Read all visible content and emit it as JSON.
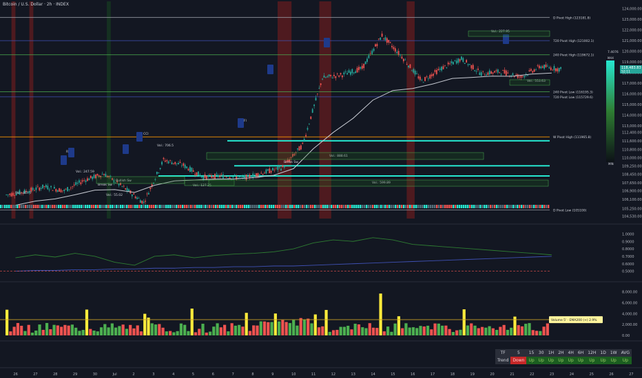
{
  "header": {
    "title": "Bitcoin / U.S. Dollar · 2h · INDEX"
  },
  "chart_data": [
    {
      "type": "line",
      "name": "price",
      "x": [
        "26",
        "27",
        "28",
        "29",
        "30",
        "Jul",
        "2",
        "3",
        "4",
        "5",
        "6",
        "7",
        "8",
        "9",
        "10",
        "11",
        "12",
        "13",
        "14",
        "15",
        "16",
        "17",
        "18",
        "19",
        "20",
        "21",
        "22",
        "23"
      ],
      "close": [
        106800,
        107300,
        106900,
        107900,
        108500,
        107200,
        105800,
        109800,
        109300,
        108200,
        108300,
        108100,
        108600,
        109100,
        111200,
        117500,
        117800,
        118400,
        121500,
        119500,
        117200,
        118400,
        119300,
        117900,
        118100,
        117600,
        118600,
        118300
      ],
      "y_ticks": [
        124000,
        123000,
        122000,
        121000,
        120000,
        119000,
        118000,
        117000,
        116000,
        115000,
        114000,
        113000,
        112400,
        111600,
        110800,
        110000,
        109250,
        108450,
        107650,
        106900,
        106100,
        105250,
        104530
      ],
      "last_price": "118,483.83",
      "last_price_sub": "52:11",
      "ylim": [
        104300,
        124300
      ],
      "pivot_lines": [
        {
          "label": "D Pivot High (123181.8)",
          "value": 123181.8,
          "color": "#9598a1"
        },
        {
          "label": "720 Pivot High (121002.1)",
          "value": 121002.1,
          "color": "#3f51b5"
        },
        {
          "label": "240 Pivot High (119672.1)",
          "value": 119672.1,
          "color": "#4caf50"
        },
        {
          "label": "240 Pivot Low (116195.3)",
          "value": 116195.3,
          "color": "#4caf50"
        },
        {
          "label": "720 Pivot Low (115729.6)",
          "value": 115729.6,
          "color": "#3f51b5"
        },
        {
          "label": "W Pivot High (111965.8)",
          "value": 111965.8,
          "color": "#ff9800"
        },
        {
          "label": "D Pivot Low (105100)",
          "value": 105100,
          "color": "#9598a1"
        }
      ],
      "annotations": [
        "Vol.: 607.7",
        "Vol.: 247.59",
        "Vol.: 706.5",
        "Vol.: 127.25",
        "Vol.: 888.61",
        "Vol.: 599.89",
        "Vol.: 553.63",
        "Vol.: 227.95",
        "Vol.: 55.02",
        "Break Sw",
        "Break Sw",
        "Bullish Sw",
        "RSI",
        "CCI",
        "MFI",
        "7.4076"
      ],
      "heatmap_labels": [
        "MAX",
        "MIN"
      ]
    },
    {
      "type": "line",
      "name": "oscillator",
      "y_ticks": [
        "1.0000",
        "0.9000",
        "0.8000",
        "0.7000",
        "0.6000",
        "0.5000"
      ],
      "ylim": [
        0.45,
        1.05
      ],
      "series": [
        {
          "values": [
            0.68,
            0.72,
            0.69,
            0.74,
            0.7,
            0.62,
            0.58,
            0.7,
            0.72,
            0.68,
            0.71,
            0.73,
            0.74,
            0.76,
            0.8,
            0.88,
            0.92,
            0.9,
            0.95,
            0.92,
            0.86,
            0.84,
            0.82,
            0.8,
            0.78,
            0.76,
            0.74,
            0.72
          ],
          "color": "#2e7d32"
        },
        {
          "values": [
            0.5,
            0.51,
            0.51,
            0.52,
            0.52,
            0.53,
            0.53,
            0.54,
            0.54,
            0.55,
            0.55,
            0.56,
            0.56,
            0.57,
            0.57,
            0.58,
            0.59,
            0.6,
            0.61,
            0.62,
            0.63,
            0.64,
            0.65,
            0.66,
            0.67,
            0.68,
            0.69,
            0.7
          ],
          "color": "#3f51b5"
        }
      ],
      "threshold": 0.5
    },
    {
      "type": "bar",
      "name": "volume",
      "y_ticks": [
        "8,000.00",
        "6,000.00",
        "4,000.00",
        "2,000.00",
        "0.00"
      ],
      "ylim": [
        0,
        8600
      ],
      "badge": "Volume 5' · EMA200 (+) 2.9%",
      "ema_level": 2900
    }
  ],
  "timeframe_table": {
    "headers": [
      "TF",
      "5",
      "15",
      "30",
      "1H",
      "2H",
      "4H",
      "6H",
      "12H",
      "1D",
      "1W",
      "AVG"
    ],
    "row_label": "Trend",
    "row_values": [
      "Down",
      "Up",
      "Up",
      "Up",
      "Up",
      "Up",
      "Up",
      "Up",
      "Up",
      "Up",
      "Up"
    ],
    "colors": {
      "up": "#1b5e20",
      "down": "#c62828"
    }
  },
  "colors": {
    "background": "#131722",
    "up": "#26a69a",
    "down": "#ef5350",
    "accent_cyan": "#26e7d0"
  }
}
